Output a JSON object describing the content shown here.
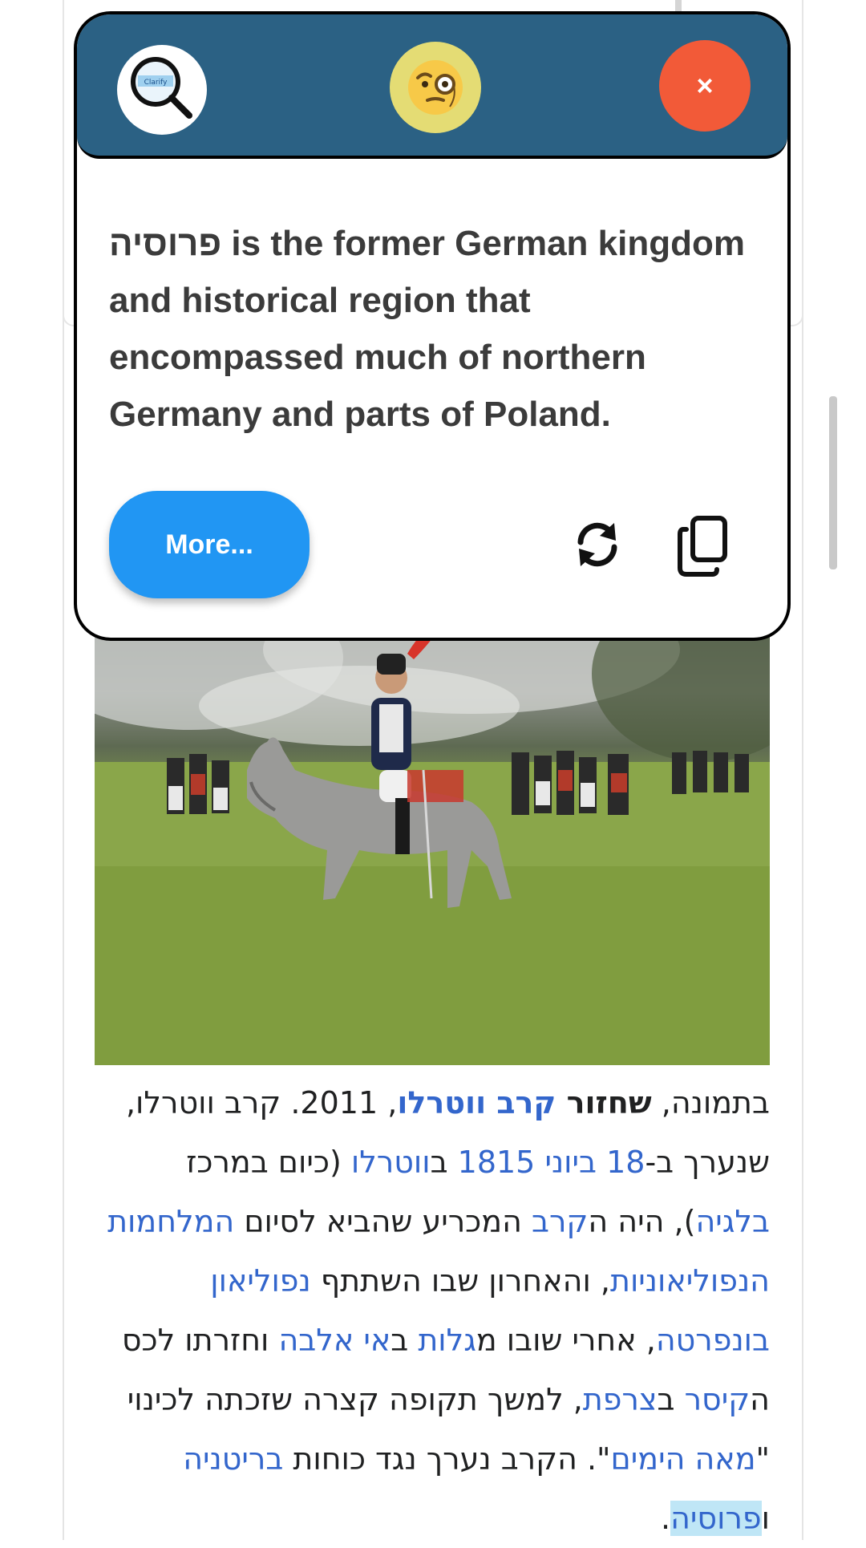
{
  "popup": {
    "header": {
      "logo_icon": "clarify-magnifier-icon",
      "logo_text": "Clarify",
      "monocle_icon": "face-with-monocle-icon",
      "close_label": "×"
    },
    "definition_text": "פרוסיה is the former German kingdom and historical region that encompassed much of northern Germany and parts of Poland.",
    "more_label": "More...",
    "refresh_icon": "refresh-icon",
    "copy_icon": "copy-icon"
  },
  "article": {
    "caption_parts": [
      {
        "text": "בתמונה, ",
        "style": "normal"
      },
      {
        "text": "שחזור ",
        "style": "bold"
      },
      {
        "text": "קרב ווטרלו",
        "style": "bold-link"
      },
      {
        "text": ", 2011. קרב ווטרלו, שנערך ב-",
        "style": "normal"
      },
      {
        "text": "18 ביוני",
        "style": "link"
      },
      {
        "text": " ",
        "style": "normal"
      },
      {
        "text": "1815",
        "style": "link"
      },
      {
        "text": " ב",
        "style": "normal"
      },
      {
        "text": "ווטרלו",
        "style": "link"
      },
      {
        "text": " (כיום במרכז ",
        "style": "normal"
      },
      {
        "text": "בלגיה",
        "style": "link"
      },
      {
        "text": "), היה ה",
        "style": "normal"
      },
      {
        "text": "קרב",
        "style": "link"
      },
      {
        "text": " המכריע שהביא לסיום ",
        "style": "normal"
      },
      {
        "text": "המלחמות הנפוליאוניות",
        "style": "link"
      },
      {
        "text": ", והאחרון שבו השתתף ",
        "style": "normal"
      },
      {
        "text": "נפוליאון בונפרטה",
        "style": "link"
      },
      {
        "text": ", אחרי שובו מ",
        "style": "normal"
      },
      {
        "text": "גלות",
        "style": "link"
      },
      {
        "text": " ב",
        "style": "normal"
      },
      {
        "text": "אי אלבה",
        "style": "link"
      },
      {
        "text": " וחזרתו לכס ה",
        "style": "normal"
      },
      {
        "text": "קיסר",
        "style": "link"
      },
      {
        "text": " ב",
        "style": "normal"
      },
      {
        "text": "צרפת",
        "style": "link"
      },
      {
        "text": ", למשך תקופה קצרה שזכתה לכינוי \"",
        "style": "normal"
      },
      {
        "text": "מאה הימים",
        "style": "link"
      },
      {
        "text": "\". הקרב נערך נגד כוחות ",
        "style": "normal"
      },
      {
        "text": "בריטניה",
        "style": "link"
      },
      {
        "text": " ו",
        "style": "normal"
      },
      {
        "text": "פרוסיה",
        "style": "link-highlight"
      },
      {
        "text": ".",
        "style": "normal"
      }
    ]
  },
  "colors": {
    "popup_header": "#2b6184",
    "close_button": "#f25a38",
    "more_button": "#2196f3",
    "link": "#3366cc",
    "highlight": "#bfe6f6"
  }
}
